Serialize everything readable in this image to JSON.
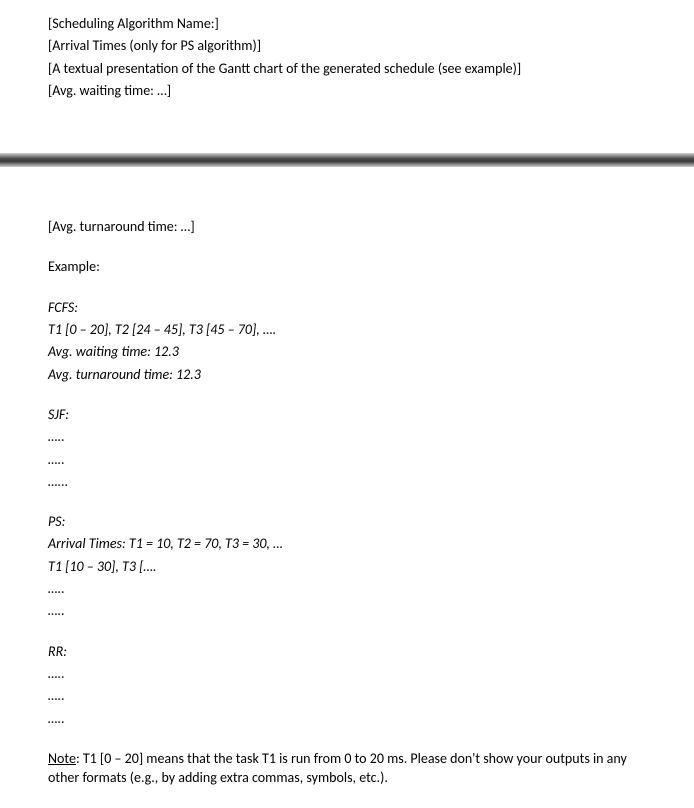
{
  "top": {
    "line1": "[Scheduling Algorithm Name:]",
    "line2": "[Arrival Times (only for PS algorithm)]",
    "line3": "[A textual presentation of the Gantt chart of the generated schedule (see example)]",
    "line4": "[Avg. waiting time: …]"
  },
  "bottom": {
    "avg_turnaround": "[Avg. turnaround time: …]",
    "example_label": "Example:",
    "fcfs": {
      "title": "FCFS:",
      "line1": "T1 [0 – 20], T2 [24 – 45], T3 [45 – 70], ….",
      "line2": "Avg. waiting time: 12.3",
      "line3": "Avg. turnaround time: 12.3"
    },
    "sjf": {
      "title": "SJF:",
      "dot1": "…..",
      "dot2": "…..",
      "dot3": "…..."
    },
    "ps": {
      "title": "PS:",
      "line1": "Arrival Times: T1 = 10, T2 = 70, T3 = 30,  …",
      "line2": "T1 [10 – 30], T3 [….",
      "dot1": "…..",
      "dot2": "….."
    },
    "rr": {
      "title": "RR:",
      "dot1": "…..",
      "dot2": "…..",
      "dot3": "….."
    },
    "note_label": "Note",
    "note_text": ": T1 [0 – 20] means that the task T1 is run from 0 to 20 ms.  Please don't show your outputs in any other formats (e.g., by adding extra commas, symbols, etc.)."
  }
}
